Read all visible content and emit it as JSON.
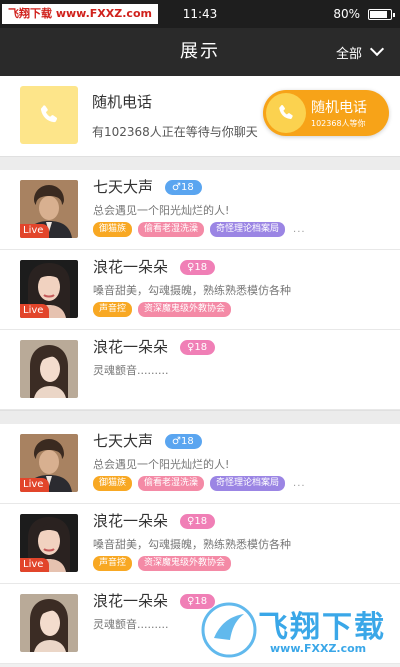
{
  "status_bar": {
    "watermark": "飞翔下载 www.FXXZ.com",
    "time": "11:43",
    "battery": "80%"
  },
  "nav": {
    "title": "展示",
    "filter_label": "全部"
  },
  "random_call": {
    "title": "随机电话",
    "subtitle": "有102368人正在等待与你聊天",
    "button_title": "随机电话",
    "button_subtitle": "102368人等你"
  },
  "sections": [
    {
      "items": [
        {
          "name": "七天大声",
          "gender_symbol": "♂",
          "gender": "male",
          "age": "18",
          "live": "Live",
          "bio": "总会遇见一个阳光灿烂的人!",
          "tags": [
            {
              "label": "御猫族",
              "color": "orange"
            },
            {
              "label": "偷看老湿洗澡",
              "color": "pink"
            },
            {
              "label": "奇怪理论档案局",
              "color": "purple"
            }
          ],
          "more": "..."
        },
        {
          "name": "浪花一朵朵",
          "gender_symbol": "♀",
          "gender": "female",
          "age": "18",
          "live": "Live",
          "bio": "嗓音甜美，勾魂摄魄，熟练熟悉模仿各种",
          "tags": [
            {
              "label": "声音控",
              "color": "orange"
            },
            {
              "label": "资深魔鬼级外教协会",
              "color": "pink"
            }
          ],
          "more": ""
        },
        {
          "name": "浪花一朵朵",
          "gender_symbol": "♀",
          "gender": "female",
          "age": "18",
          "live": "",
          "bio": "灵魂颤音.........",
          "tags": [],
          "more": ""
        }
      ]
    },
    {
      "items": [
        {
          "name": "七天大声",
          "gender_symbol": "♂",
          "gender": "male",
          "age": "18",
          "live": "Live",
          "bio": "总会遇见一个阳光灿烂的人!",
          "tags": [
            {
              "label": "御猫族",
              "color": "orange"
            },
            {
              "label": "偷看老湿洗澡",
              "color": "pink"
            },
            {
              "label": "奇怪理论档案局",
              "color": "purple"
            }
          ],
          "more": "..."
        },
        {
          "name": "浪花一朵朵",
          "gender_symbol": "♀",
          "gender": "female",
          "age": "18",
          "live": "Live",
          "bio": "嗓音甜美，勾魂摄魄，熟练熟悉模仿各种",
          "tags": [
            {
              "label": "声音控",
              "color": "orange"
            },
            {
              "label": "资深魔鬼级外教协会",
              "color": "pink"
            }
          ],
          "more": ""
        },
        {
          "name": "浪花一朵朵",
          "gender_symbol": "♀",
          "gender": "female",
          "age": "18",
          "live": "",
          "bio": "灵魂颤音.........",
          "tags": [],
          "more": ""
        }
      ]
    }
  ],
  "bottom_watermark": {
    "title": "飞翔下载",
    "url": "www.FXXZ.com"
  },
  "colors": {
    "accent_orange": "#f7a318",
    "tile_yellow": "#fde58a",
    "male_blue": "#5aa5f0",
    "female_pink": "#f07fb6",
    "tag_orange": "#f8a823",
    "tag_pink": "#f48aa6",
    "tag_purple": "#9b85e4"
  }
}
